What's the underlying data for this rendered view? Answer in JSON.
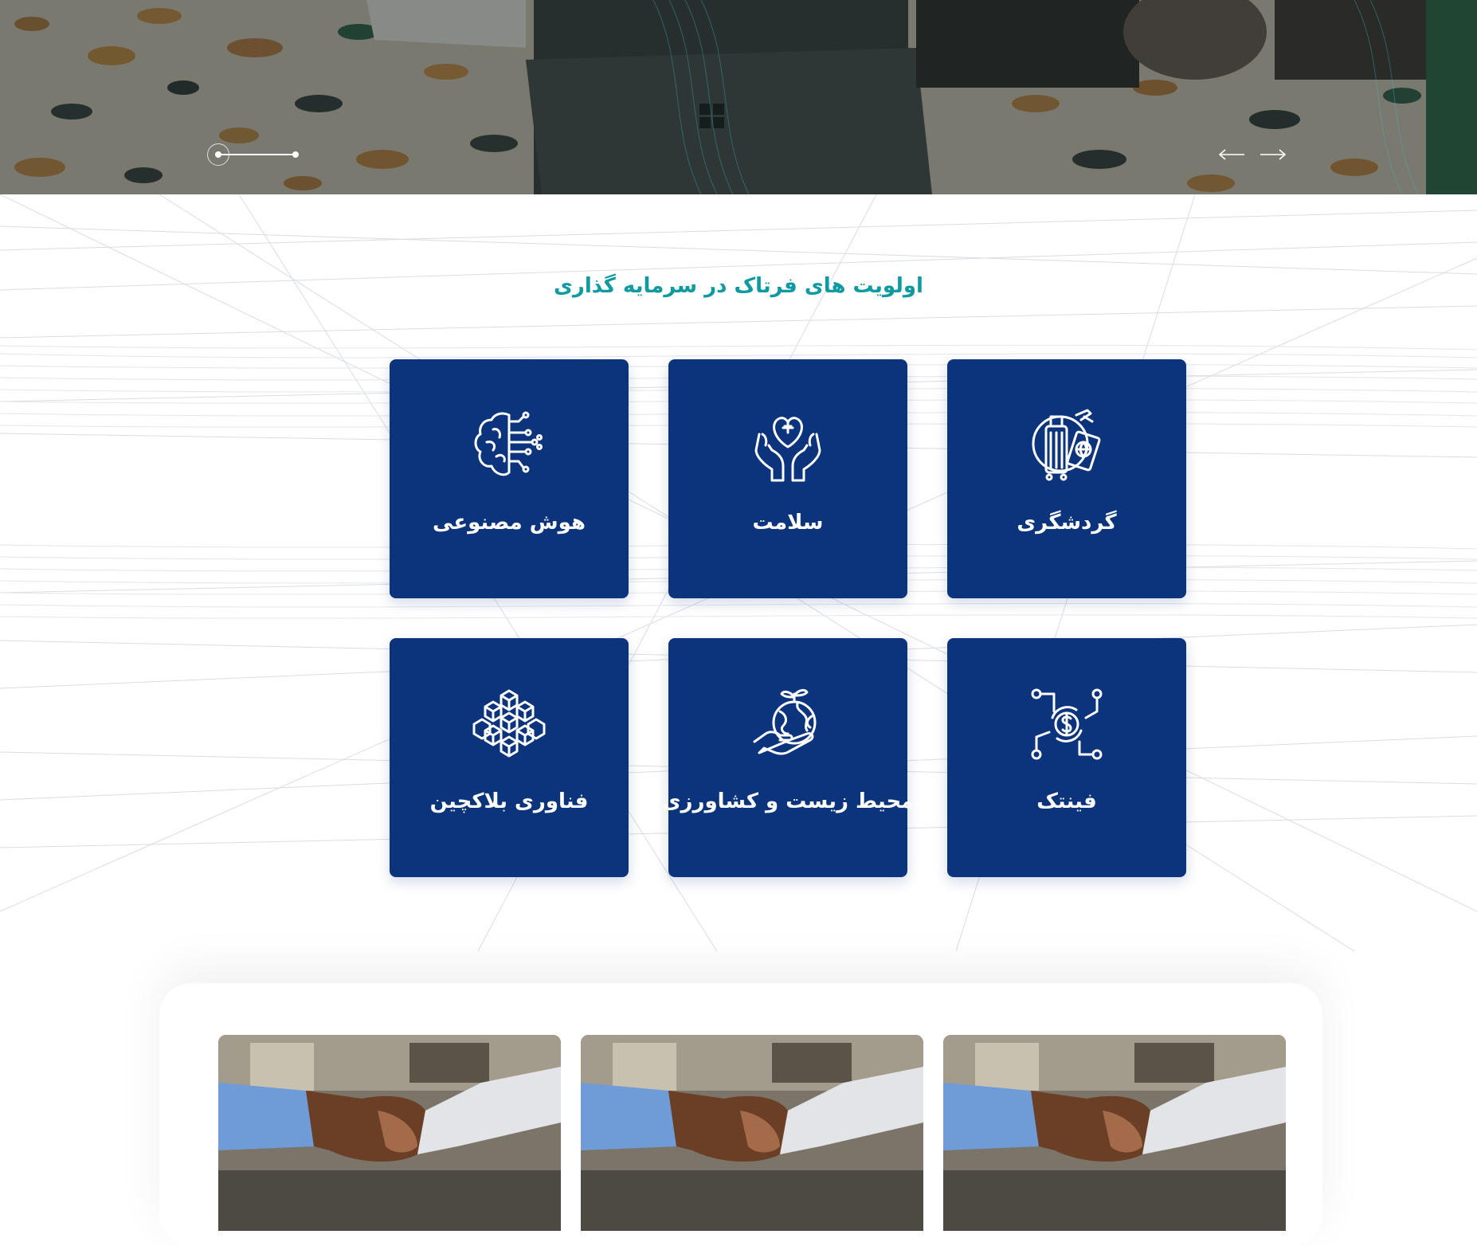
{
  "hero": {
    "slider": {
      "current_slide": 1,
      "total_slides": 2
    },
    "nav": {
      "prev_icon": "arrow-left-icon",
      "next_icon": "arrow-right-icon"
    }
  },
  "priorities": {
    "title": "اولویت های فرتاک در سرمایه گذاری",
    "cards": [
      {
        "label": "گردشگری",
        "icon": "tourism-luggage-icon"
      },
      {
        "label": "سلامت",
        "icon": "health-hands-heart-icon"
      },
      {
        "label": "هوش مصنوعی",
        "icon": "ai-brain-circuit-icon"
      },
      {
        "label": "فینتک",
        "icon": "fintech-dollar-network-icon"
      },
      {
        "label": "محیط زیست و کشاورزی",
        "icon": "environment-globe-hand-icon"
      },
      {
        "label": "فناوری بلاکچین",
        "icon": "blockchain-cubes-icon"
      }
    ]
  },
  "photo_cards": [
    {
      "image": "handshake-photo"
    },
    {
      "image": "handshake-photo"
    },
    {
      "image": "handshake-photo"
    }
  ],
  "colors": {
    "card_background": "#0b347d",
    "title_accent": "#0e9aa0",
    "card_text": "#ffffff"
  }
}
